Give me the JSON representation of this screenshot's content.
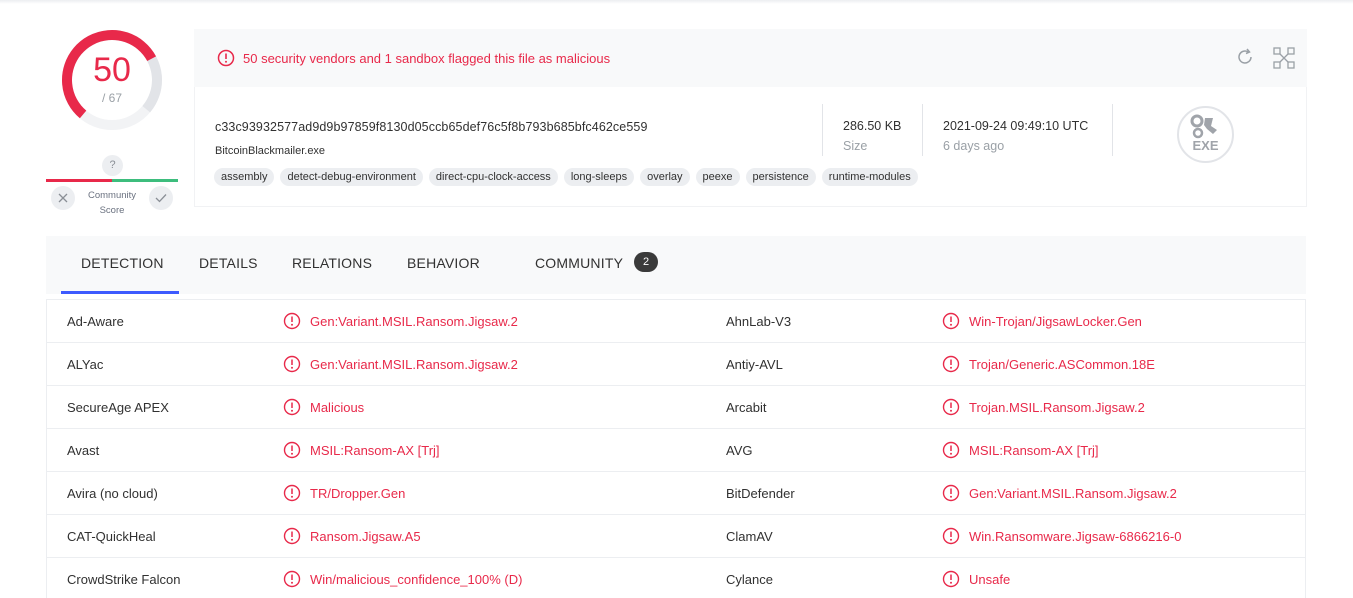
{
  "score": {
    "detected": "50",
    "total": "/ 67",
    "fraction": 0.746,
    "color": "#e8294a"
  },
  "community": {
    "question": "?",
    "label_line1": "Community",
    "label_line2": "Score"
  },
  "alert": {
    "message": "50 security vendors and 1 sandbox flagged this file as malicious"
  },
  "file": {
    "hash": "c33c93932577ad9d9b97859f8130d05ccb65def76c5f8b793b685bfc462ce559",
    "name": "BitcoinBlackmailer.exe",
    "size_value": "286.50 KB",
    "size_label": "Size",
    "date_value": "2021-09-24 09:49:10 UTC",
    "date_label": "6 days ago",
    "type_badge": "EXE",
    "tags": [
      "assembly",
      "detect-debug-environment",
      "direct-cpu-clock-access",
      "long-sleeps",
      "overlay",
      "peexe",
      "persistence",
      "runtime-modules"
    ]
  },
  "tabs": {
    "detection": "DETECTION",
    "details": "DETAILS",
    "relations": "RELATIONS",
    "behavior": "BEHAVIOR",
    "community": "COMMUNITY",
    "community_count": "2",
    "active": "DETECTION",
    "accent": "#3d5afe"
  },
  "detections": [
    {
      "v1": "Ad-Aware",
      "r1": "Gen:Variant.MSIL.Ransom.Jigsaw.2",
      "v2": "AhnLab-V3",
      "r2": "Win-Trojan/JigsawLocker.Gen"
    },
    {
      "v1": "ALYac",
      "r1": "Gen:Variant.MSIL.Ransom.Jigsaw.2",
      "v2": "Antiy-AVL",
      "r2": "Trojan/Generic.ASCommon.18E"
    },
    {
      "v1": "SecureAge APEX",
      "r1": "Malicious",
      "v2": "Arcabit",
      "r2": "Trojan.MSIL.Ransom.Jigsaw.2"
    },
    {
      "v1": "Avast",
      "r1": "MSIL:Ransom-AX [Trj]",
      "v2": "AVG",
      "r2": "MSIL:Ransom-AX [Trj]"
    },
    {
      "v1": "Avira (no cloud)",
      "r1": "TR/Dropper.Gen",
      "v2": "BitDefender",
      "r2": "Gen:Variant.MSIL.Ransom.Jigsaw.2"
    },
    {
      "v1": "CAT-QuickHeal",
      "r1": "Ransom.Jigsaw.A5",
      "v2": "ClamAV",
      "r2": "Win.Ransomware.Jigsaw-6866216-0"
    },
    {
      "v1": "CrowdStrike Falcon",
      "r1": "Win/malicious_confidence_100% (D)",
      "v2": "Cylance",
      "r2": "Unsafe"
    }
  ]
}
